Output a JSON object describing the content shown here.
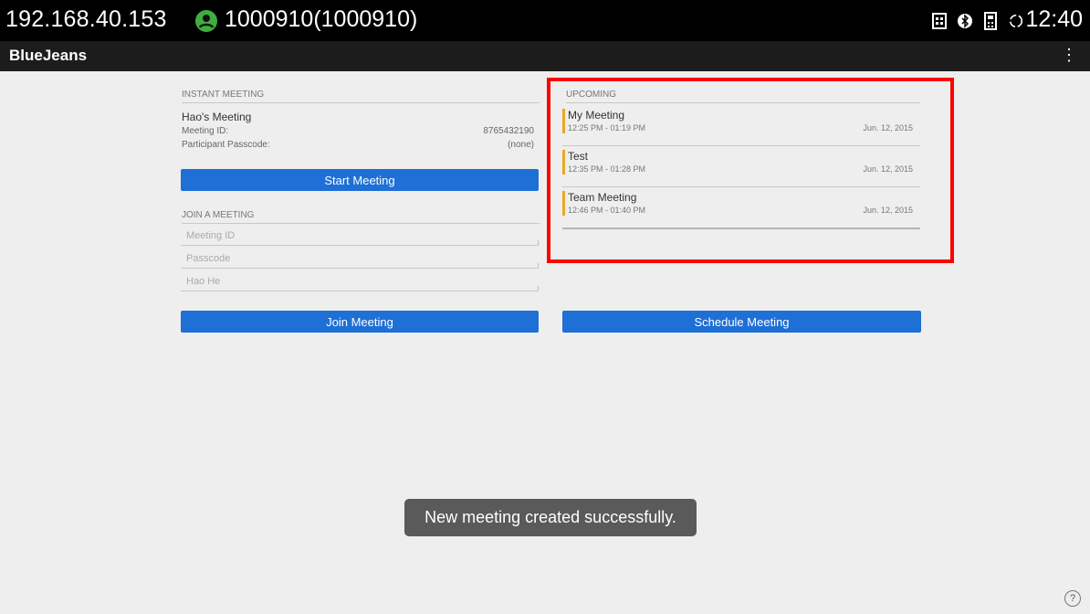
{
  "status_bar": {
    "ip": "192.168.40.153",
    "account": "1000910(1000910)",
    "time": "12:40",
    "icons": [
      "contacts-book-icon",
      "bluetooth-icon",
      "dialpad-icon",
      "sync-icon"
    ]
  },
  "app_bar": {
    "title": "BlueJeans",
    "menu_icon": "⋮"
  },
  "instant_meeting": {
    "section_label": "INSTANT MEETING",
    "title": "Hao's Meeting",
    "meeting_id_label": "Meeting ID:",
    "meeting_id_value": "8765432190",
    "passcode_label": "Participant Passcode:",
    "passcode_value": "(none)",
    "start_button": "Start Meeting"
  },
  "join_meeting": {
    "section_label": "JOIN A MEETING",
    "meeting_id_placeholder": "Meeting ID",
    "passcode_placeholder": "Passcode",
    "name_value": "Hao He",
    "join_button": "Join Meeting"
  },
  "upcoming": {
    "section_label": "UPCOMING",
    "items": [
      {
        "title": "My Meeting",
        "time": "12:25 PM - 01:19 PM",
        "date": "Jun. 12, 2015"
      },
      {
        "title": "Test",
        "time": "12:35 PM - 01:28 PM",
        "date": "Jun. 12, 2015"
      },
      {
        "title": "Team Meeting",
        "time": "12:46 PM - 01:40 PM",
        "date": "Jun. 12, 2015"
      }
    ],
    "schedule_button": "Schedule Meeting"
  },
  "toast": "New meeting created successfully.",
  "help_icon": "?",
  "colors": {
    "accent": "#1e6fd6",
    "highlight": "#ff0000",
    "meeting_bar": "#e7a929"
  }
}
